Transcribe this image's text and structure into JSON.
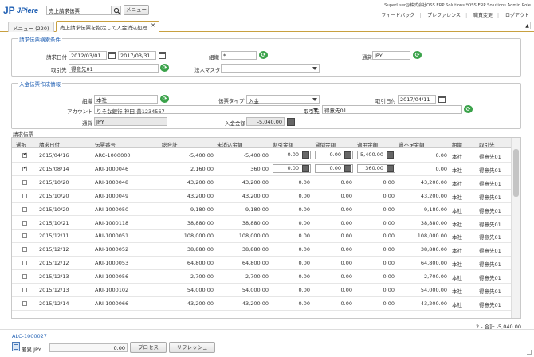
{
  "header": {
    "logo_text": "JPiere",
    "search_value": "売上請求伝票",
    "menu_button": "メニュー",
    "user_info": "SuperUser@株式会社OSS ERP Solutions.*OSS ERP Solutions Admin Role",
    "links": [
      "フィードバック",
      "プレファレンス",
      "職責変更",
      "ログアウト"
    ]
  },
  "tabs": [
    {
      "label": "メニュー (220)"
    },
    {
      "label": "売上請求伝票を指定して入金消込処理"
    }
  ],
  "search_section": {
    "legend": "請求伝票検索条件",
    "date_label": "請求日付",
    "date_from": "2012/03/01",
    "date_to": "2017/03/31",
    "org_label": "組織",
    "org_value": "*",
    "currency_label": "通貨",
    "currency_value": "JPY",
    "bp_label": "取引先",
    "bp_value": "得意先01",
    "corp_label": "法人マスタ",
    "corp_value": ""
  },
  "payment_section": {
    "legend": "入金伝票作成情報",
    "org_label": "組織",
    "org_value": "本社",
    "doctype_label": "伝票タイプ",
    "doctype_value": "入金",
    "trxdate_label": "取引日付",
    "trxdate_value": "2017/04/11",
    "account_label": "アカウント",
    "account_value": "りそな銀行-神田-普1234567",
    "bp_label": "取引先",
    "bp_value": "得意先01",
    "currency_label": "通貨",
    "currency_value": "JPY",
    "amount_label": "入金金額",
    "amount_value": "-5,040.00"
  },
  "grid": {
    "title": "請求伝票",
    "columns": [
      "選択",
      "請求日付",
      "伝票番号",
      "総合計",
      "未消込金額",
      "割引金額",
      "貸倒金額",
      "適用金額",
      "過不足金額",
      "組織",
      "取引先"
    ],
    "rows": [
      {
        "sel": true,
        "date": "2015/04/16",
        "doc": "ARC-1000000",
        "total": "-5,400.00",
        "open": "-5,400.00",
        "disc": "0.00",
        "wo": "0.00",
        "applied": "-5,400.00",
        "over": "0.00",
        "org": "本社",
        "bp": "得意先01",
        "edit": true
      },
      {
        "sel": true,
        "date": "2015/08/14",
        "doc": "ARI-1000046",
        "total": "2,160.00",
        "open": "360.00",
        "disc": "0.00",
        "wo": "0.00",
        "applied": "360.00",
        "over": "0.00",
        "org": "本社",
        "bp": "得意先01",
        "edit": true
      },
      {
        "sel": false,
        "date": "2015/10/20",
        "doc": "ARI-1000048",
        "total": "43,200.00",
        "open": "43,200.00",
        "disc": "0.00",
        "wo": "0.00",
        "applied": "0.00",
        "over": "43,200.00",
        "org": "本社",
        "bp": "得意先01",
        "edit": false
      },
      {
        "sel": false,
        "date": "2015/10/20",
        "doc": "ARI-1000049",
        "total": "43,200.00",
        "open": "43,200.00",
        "disc": "0.00",
        "wo": "0.00",
        "applied": "0.00",
        "over": "43,200.00",
        "org": "本社",
        "bp": "得意先01",
        "edit": false
      },
      {
        "sel": false,
        "date": "2015/10/20",
        "doc": "ARI-1000050",
        "total": "9,180.00",
        "open": "9,180.00",
        "disc": "0.00",
        "wo": "0.00",
        "applied": "0.00",
        "over": "9,180.00",
        "org": "本社",
        "bp": "得意先01",
        "edit": false
      },
      {
        "sel": false,
        "date": "2015/10/21",
        "doc": "ARI-1000118",
        "total": "38,880.00",
        "open": "38,880.00",
        "disc": "0.00",
        "wo": "0.00",
        "applied": "0.00",
        "over": "38,880.00",
        "org": "本社",
        "bp": "得意先01",
        "edit": false
      },
      {
        "sel": false,
        "date": "2015/12/11",
        "doc": "ARI-1000051",
        "total": "108,000.00",
        "open": "108,000.00",
        "disc": "0.00",
        "wo": "0.00",
        "applied": "0.00",
        "over": "108,000.00",
        "org": "本社",
        "bp": "得意先01",
        "edit": false
      },
      {
        "sel": false,
        "date": "2015/12/12",
        "doc": "ARI-1000052",
        "total": "38,880.00",
        "open": "38,880.00",
        "disc": "0.00",
        "wo": "0.00",
        "applied": "0.00",
        "over": "38,880.00",
        "org": "本社",
        "bp": "得意先01",
        "edit": false
      },
      {
        "sel": false,
        "date": "2015/12/12",
        "doc": "ARI-1000053",
        "total": "64,800.00",
        "open": "64,800.00",
        "disc": "0.00",
        "wo": "0.00",
        "applied": "0.00",
        "over": "64,800.00",
        "org": "本社",
        "bp": "得意先01",
        "edit": false
      },
      {
        "sel": false,
        "date": "2015/12/13",
        "doc": "ARI-1000056",
        "total": "2,700.00",
        "open": "2,700.00",
        "disc": "0.00",
        "wo": "0.00",
        "applied": "0.00",
        "over": "2,700.00",
        "org": "本社",
        "bp": "得意先01",
        "edit": false
      },
      {
        "sel": false,
        "date": "2015/12/13",
        "doc": "ARI-1000102",
        "total": "54,000.00",
        "open": "54,000.00",
        "disc": "0.00",
        "wo": "0.00",
        "applied": "0.00",
        "over": "54,000.00",
        "org": "本社",
        "bp": "得意先01",
        "edit": false
      },
      {
        "sel": false,
        "date": "2015/12/14",
        "doc": "ARI-1000066",
        "total": "43,200.00",
        "open": "43,200.00",
        "disc": "0.00",
        "wo": "0.00",
        "applied": "0.00",
        "over": "43,200.00",
        "org": "本社",
        "bp": "得意先01",
        "edit": false
      }
    ],
    "footer_summary": "2 - 合計 -5,040.00"
  },
  "footer": {
    "link": "ALC-1000027",
    "diff_label": "差異 JPY",
    "diff_value": "0.00",
    "process_button": "プロセス",
    "refresh_button": "リフレッシュ"
  }
}
